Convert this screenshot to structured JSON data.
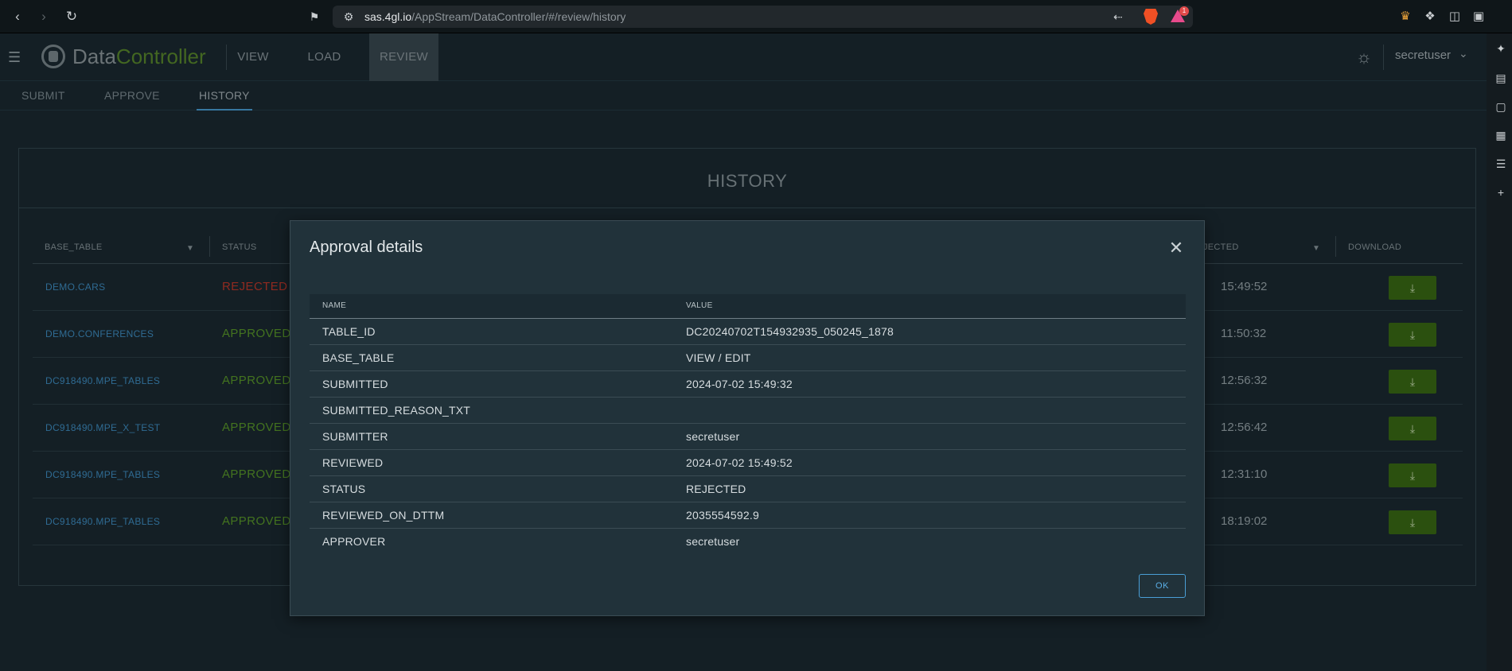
{
  "browser": {
    "url_host": "sas.4gl.io",
    "url_path": "/AppStream/DataController/#/review/history",
    "brave_badge": "1"
  },
  "header": {
    "logo_part1": "Data",
    "logo_part2": "Controller",
    "tabs": [
      {
        "label": "VIEW"
      },
      {
        "label": "LOAD"
      },
      {
        "label": "REVIEW"
      }
    ],
    "user": "secretuser"
  },
  "subnav": {
    "tabs": [
      {
        "label": "SUBMIT"
      },
      {
        "label": "APPROVE"
      },
      {
        "label": "HISTORY"
      }
    ]
  },
  "history": {
    "title": "HISTORY",
    "columns": {
      "base_table": "BASE_TABLE",
      "status": "STATUS",
      "rejected": "JECTED",
      "download": "DOWNLOAD"
    },
    "rows": [
      {
        "base_table": "DEMO.CARS",
        "status": "REJECTED",
        "time": "15:49:52"
      },
      {
        "base_table": "DEMO.CONFERENCES",
        "status": "APPROVED",
        "time": "11:50:32"
      },
      {
        "base_table": "DC918490.MPE_TABLES",
        "status": "APPROVED",
        "time": "12:56:32"
      },
      {
        "base_table": "DC918490.MPE_X_TEST",
        "status": "APPROVED",
        "time": "12:56:42"
      },
      {
        "base_table": "DC918490.MPE_TABLES",
        "status": "APPROVED",
        "time": "12:31:10"
      },
      {
        "base_table": "DC918490.MPE_TABLES",
        "status": "APPROVED",
        "time": "18:19:02"
      }
    ]
  },
  "colors": {
    "rejected": "#c0392b",
    "approved": "#5a9a2a",
    "link": "#3f8fc4"
  },
  "modal": {
    "title": "Approval details",
    "col_name": "NAME",
    "col_value": "VALUE",
    "rows": [
      {
        "name": "TABLE_ID",
        "value": "DC20240702T154932935_050245_1878"
      },
      {
        "name": "BASE_TABLE",
        "value": "VIEW / EDIT"
      },
      {
        "name": "SUBMITTED",
        "value": "2024-07-02 15:49:32"
      },
      {
        "name": "SUBMITTED_REASON_TXT",
        "value": ""
      },
      {
        "name": "SUBMITTER",
        "value": "secretuser"
      },
      {
        "name": "REVIEWED",
        "value": "2024-07-02 15:49:52"
      },
      {
        "name": "STATUS",
        "value": "REJECTED"
      },
      {
        "name": "REVIEWED_ON_DTTM",
        "value": "2035554592.9"
      },
      {
        "name": "APPROVER",
        "value": "secretuser"
      }
    ],
    "ok_label": "OK"
  }
}
